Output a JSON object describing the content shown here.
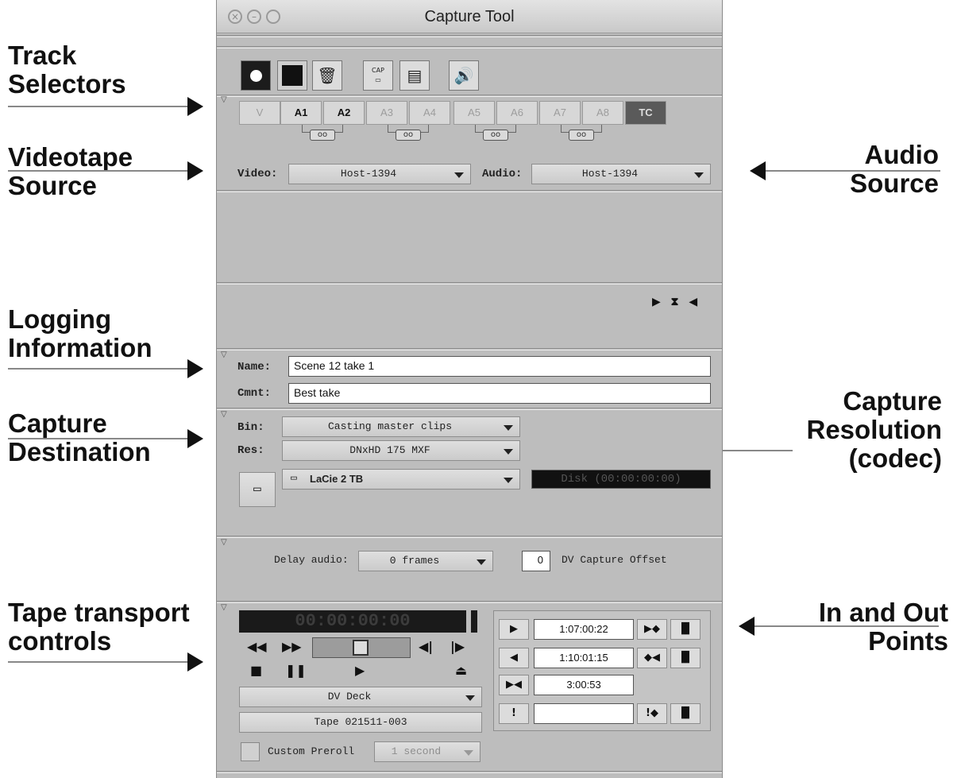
{
  "window": {
    "title": "Capture Tool"
  },
  "callouts": {
    "track_selectors": [
      "Track",
      "Selectors"
    ],
    "videotape_source": [
      "Videotape",
      "Source"
    ],
    "audio_source": [
      "Audio",
      "Source"
    ],
    "logging_information": [
      "Logging",
      "Information"
    ],
    "capture_destination": [
      "Capture",
      "Destination"
    ],
    "capture_resolution": [
      "Capture",
      "Resolution",
      "(codec)"
    ],
    "tape_transport": [
      "Tape transport",
      "controls"
    ],
    "in_out_points": [
      "In and Out",
      "Points"
    ]
  },
  "toolbar": {
    "icons": [
      "record-icon",
      "stop-square-icon",
      "trash-icon",
      "capture-icon",
      "deck-icon",
      "speaker-icon"
    ],
    "cap_label": "CAP"
  },
  "tracks": {
    "labels": [
      "V",
      "A1",
      "A2",
      "A3",
      "A4",
      "A5",
      "A6",
      "A7",
      "A8",
      "TC"
    ],
    "link_glyph": "oo"
  },
  "source": {
    "video_label": "Video:",
    "video_value": "Host-1394",
    "audio_label": "Audio:",
    "audio_value": "Host-1394"
  },
  "mid_icons": "▶ ⧗ ◀",
  "logging": {
    "name_label": "Name:",
    "name_value": "Scene 12 take 1",
    "cmnt_label": "Cmnt:",
    "cmnt_value": "Best take"
  },
  "destination": {
    "bin_label": "Bin:",
    "bin_value": "Casting master clips",
    "res_label": "Res:",
    "res_value": "DNxHD 175  MXF",
    "drive_value": "LaCie 2 TB",
    "disk_text": "Disk (00:00:00:00)"
  },
  "delay": {
    "label": "Delay audio:",
    "value": "0 frames",
    "offset_value": "0",
    "offset_label": "DV Capture Offset"
  },
  "transport": {
    "timecode": "00:00:00:00",
    "deck": "DV Deck",
    "tape": "Tape 021511-003",
    "preroll_label": "Custom Preroll",
    "preroll_value": "1 second"
  },
  "inout": {
    "in": "1:07:00:22",
    "out": "1:10:01:15",
    "duration": "3:00:53",
    "extra": ""
  }
}
